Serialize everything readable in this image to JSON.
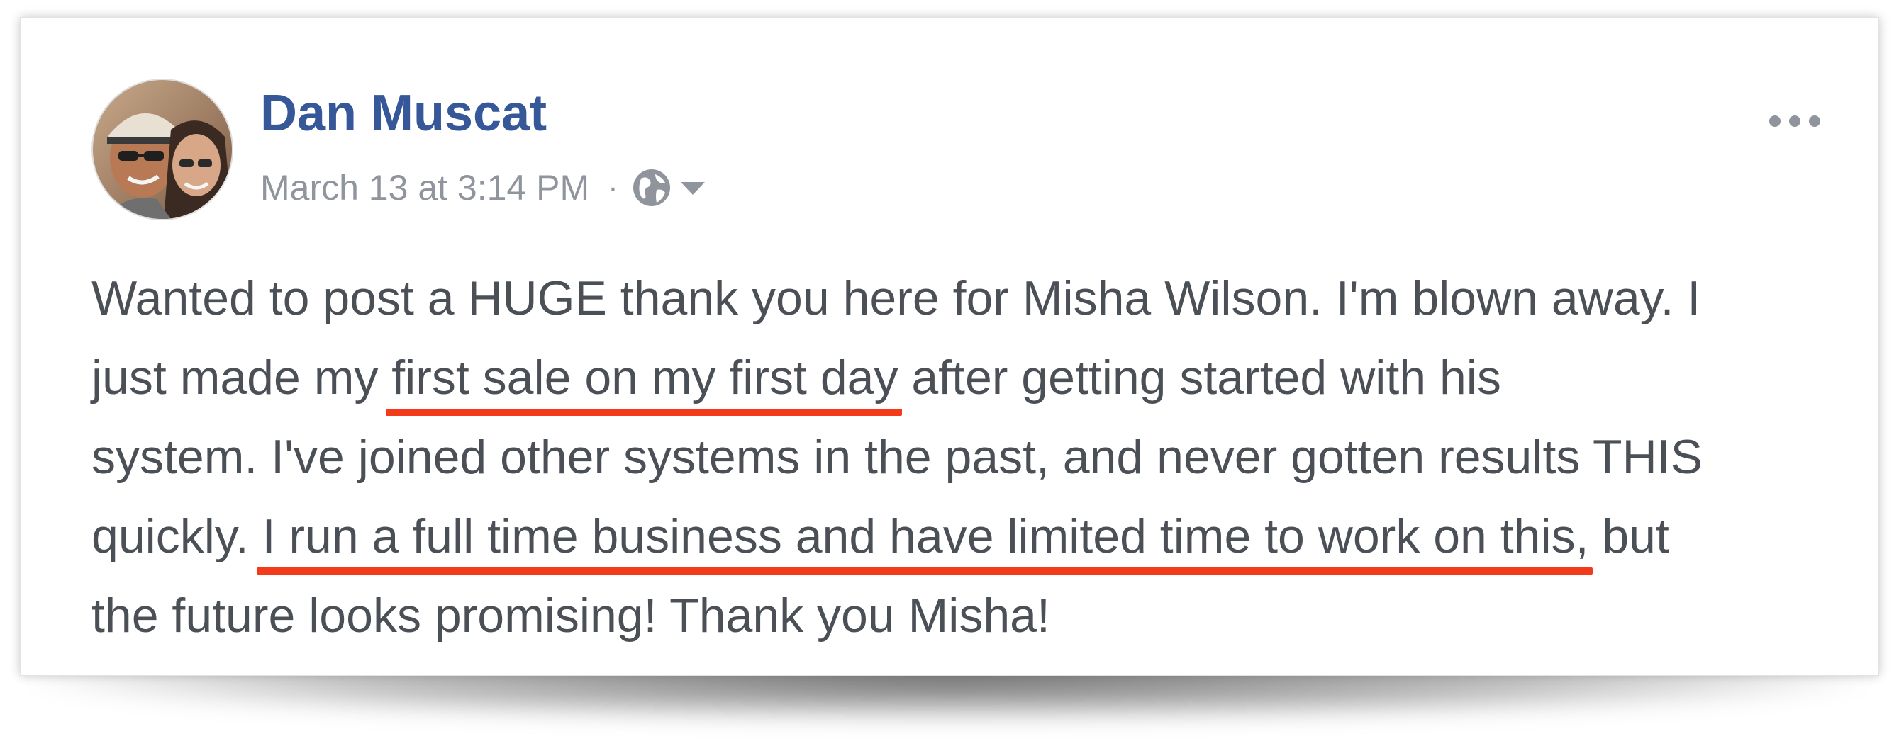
{
  "post": {
    "author": "Dan Muscat",
    "timestamp": "March 13 at 3:14 PM",
    "separator": "·",
    "privacy_icon": "globe-icon",
    "audience_menu_icon": "caret-down-icon",
    "more_icon": "more-options-icon",
    "body": {
      "line1": "Wanted to post a HUGE thank you here for Misha Wilson. I'm blown away. I",
      "line2_before": "just made my ",
      "line2_highlight": "first sale on my first day",
      "line2_after": " after getting started with his",
      "line3": "system. I've joined other systems in the past, and never gotten results THIS",
      "line4_before": "quickly. ",
      "line4_highlight": "I run a full time business and have limited time to work on this,",
      "line4_after": " but",
      "line5": "the future looks promising! Thank you Misha!"
    }
  },
  "colors": {
    "name": "#365899",
    "meta": "#90949c",
    "body_text": "#4b4f56",
    "underline": "#f33b1b"
  }
}
